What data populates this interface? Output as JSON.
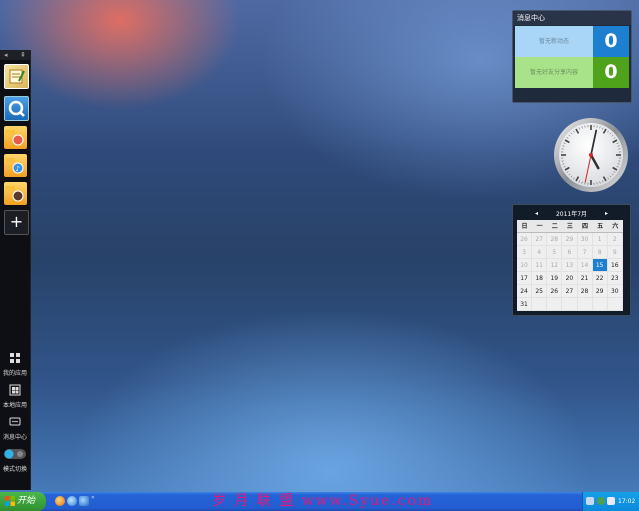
{
  "sidebar": {
    "collapse_arrow": "◂",
    "pin_icon": "⇞",
    "add_label": "+",
    "bottom": [
      {
        "label": "我的应用",
        "icon": "grid-icon"
      },
      {
        "label": "本地应用",
        "icon": "windows-icon"
      },
      {
        "label": "消息中心",
        "icon": "message-icon"
      },
      {
        "label": "模式切换",
        "icon": "toggle-icon"
      }
    ]
  },
  "message_widget": {
    "title": "消息中心",
    "rows": [
      {
        "label": "暂无新动态",
        "count": "0",
        "color": "#1c7fd0"
      },
      {
        "label": "暂无好友分享内容",
        "count": "0",
        "color": "#4ea31a"
      }
    ]
  },
  "calendar": {
    "prev": "◂",
    "next": "▸",
    "title": "2011年7月",
    "weekdays": [
      "日",
      "一",
      "二",
      "三",
      "四",
      "五",
      "六"
    ],
    "weeks": [
      [
        "26",
        "27",
        "28",
        "29",
        "30",
        "1",
        "2"
      ],
      [
        "3",
        "4",
        "5",
        "6",
        "7",
        "8",
        "9"
      ],
      [
        "10",
        "11",
        "12",
        "13",
        "14",
        "15",
        "16"
      ],
      [
        "17",
        "18",
        "19",
        "20",
        "21",
        "22",
        "23"
      ],
      [
        "24",
        "25",
        "26",
        "27",
        "28",
        "29",
        "30"
      ],
      [
        "31",
        "",
        "",
        "",
        "",
        "",
        ""
      ]
    ],
    "today": "15",
    "accent": "#1f7fcf"
  },
  "clock": {
    "hour": 5,
    "minute": 2,
    "second": 32
  },
  "taskbar": {
    "start_label": "开始",
    "quicklaunch_more": "»",
    "watermark": "岁 月 联 盟  www.Syue.com",
    "time": "17:02"
  }
}
